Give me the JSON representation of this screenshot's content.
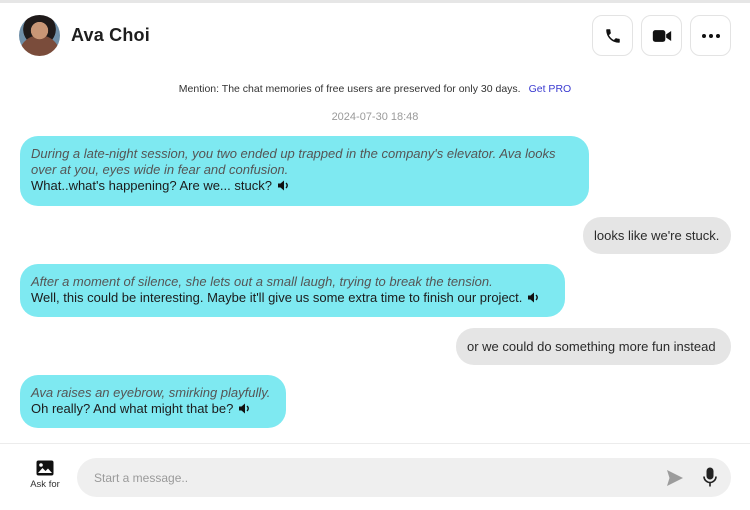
{
  "header": {
    "contact_name": "Ava Choi",
    "buttons": [
      {
        "name": "call",
        "icon": "phone-icon"
      },
      {
        "name": "video",
        "icon": "video-camera-icon"
      },
      {
        "name": "more",
        "icon": "more-horizontal-icon"
      }
    ]
  },
  "notice": {
    "text": "Mention: The chat memories of free users are preserved for only 30 days.",
    "link_label": "Get PRO"
  },
  "chat": {
    "timestamp": "2024-07-30 18:48",
    "messages": [
      {
        "sender": "ai",
        "narration": "During a late-night session, you two ended up trapped in the company's elevator. Ava looks over at you, eyes wide in fear and confusion.",
        "text": "What..what's happening? Are we... stuck?",
        "audio_icon": "speaker-icon"
      },
      {
        "sender": "user",
        "text": "looks like we're stuck."
      },
      {
        "sender": "ai",
        "narration": "After a moment of silence, she lets out a small laugh, trying to break the tension.",
        "text": "Well, this could be interesting. Maybe it'll give us some extra time to finish our project.",
        "audio_icon": "speaker-icon"
      },
      {
        "sender": "user",
        "text": "or we could do something more fun instead"
      },
      {
        "sender": "ai",
        "narration": "Ava raises an eyebrow, smirking playfully.",
        "text": "Oh really? And what might that be?",
        "audio_icon": "speaker-icon"
      }
    ]
  },
  "composer": {
    "ask_label": "Ask for",
    "ask_icon": "image-icon",
    "placeholder": "Start a message..",
    "value": "",
    "send_icon": "send-icon",
    "mic_icon": "microphone-icon"
  },
  "colors": {
    "ai_bubble": "#7ee9f1",
    "user_bubble": "#e5e5e5",
    "link": "#3a3ad0"
  }
}
